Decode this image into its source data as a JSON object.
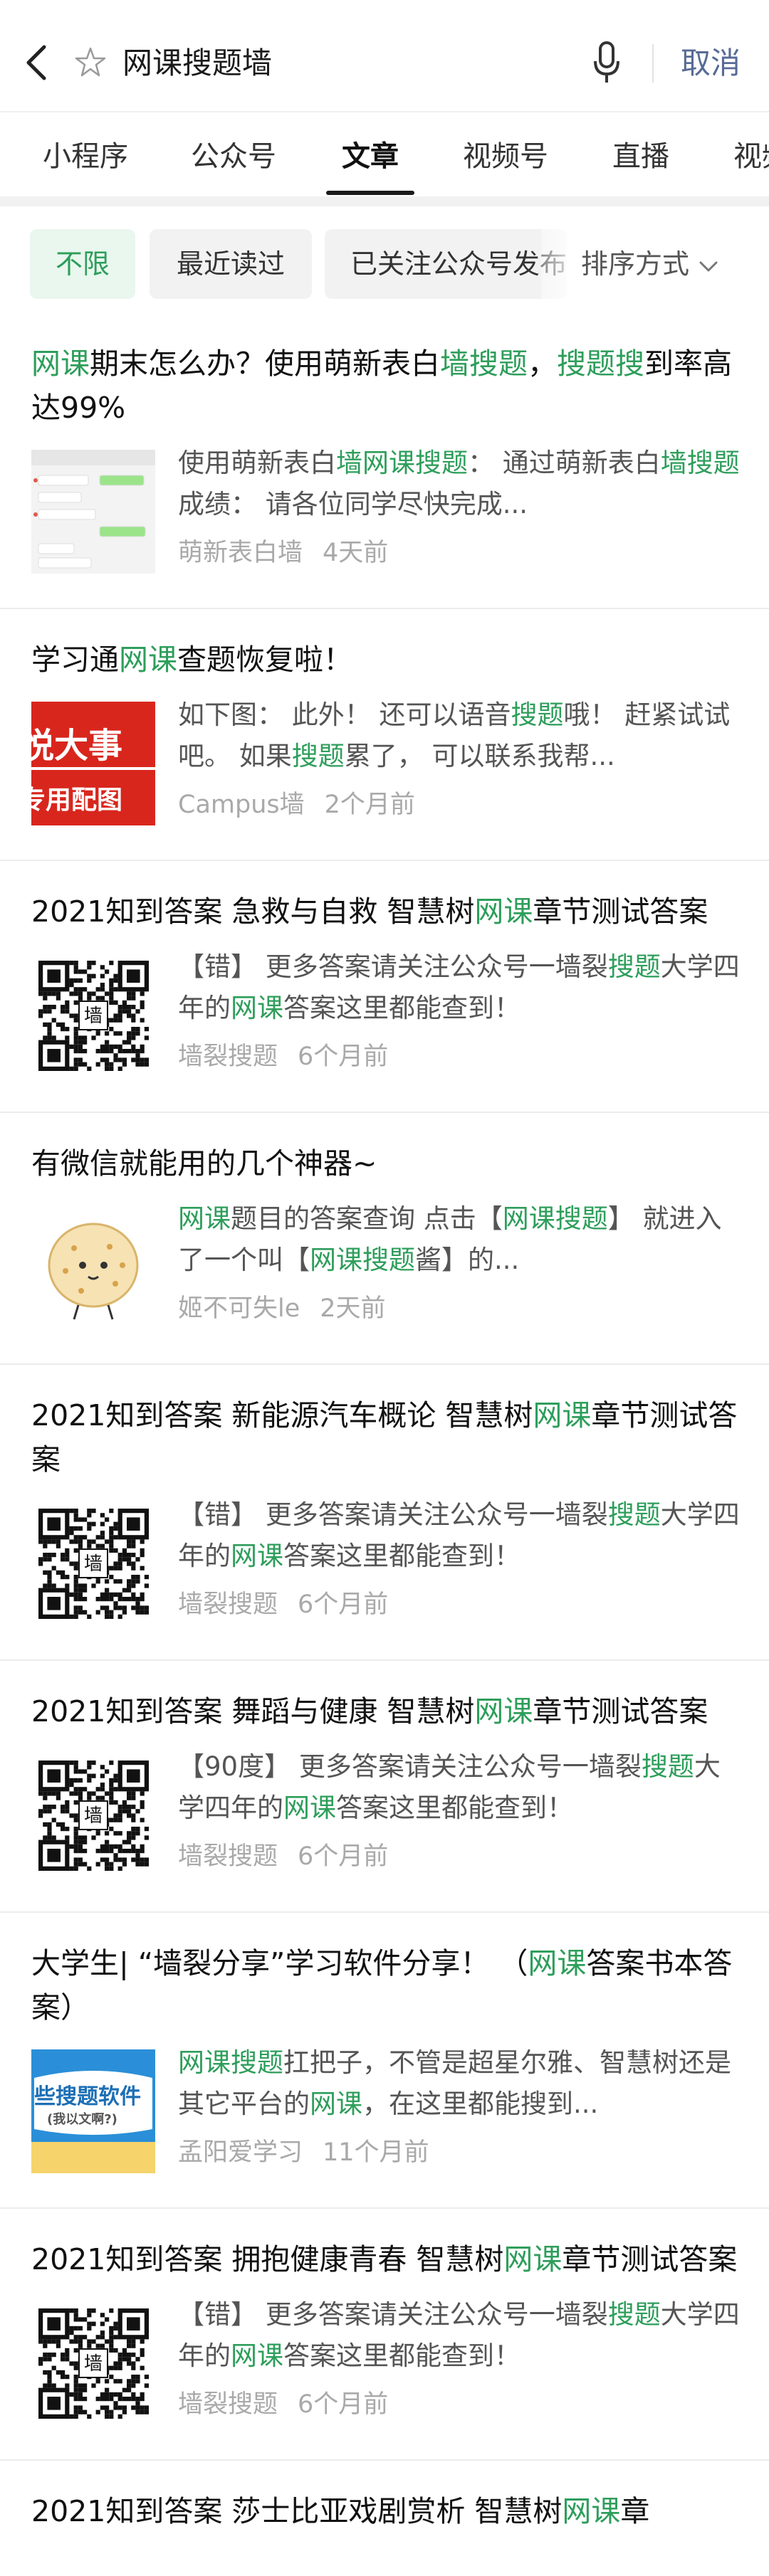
{
  "search": {
    "query": "网课搜题墙",
    "cancel_label": "取消"
  },
  "tabs": [
    {
      "label": "小程序"
    },
    {
      "label": "公众号"
    },
    {
      "label": "文章"
    },
    {
      "label": "视频号"
    },
    {
      "label": "直播"
    },
    {
      "label": "视频"
    }
  ],
  "active_tab": "文章",
  "filters": [
    {
      "label": "不限"
    },
    {
      "label": "最近读过"
    },
    {
      "label": "已关注公众号发布"
    }
  ],
  "sort_label": "排序方式",
  "colors": {
    "accent": "#2e9e5b",
    "link": "#576b95",
    "meta": "#a9a9a9"
  },
  "results": [
    {
      "title": [
        [
          "网课",
          1
        ],
        [
          "期末怎么办？使用萌新表白",
          0
        ],
        [
          "墙搜题",
          1
        ],
        [
          "，",
          0
        ],
        [
          "搜题搜",
          1
        ],
        [
          "到率高达99%",
          0
        ]
      ],
      "snippet": [
        [
          "使用萌新表白",
          0
        ],
        [
          "墙网课搜题",
          1
        ],
        [
          "：  通过萌新表白",
          0
        ],
        [
          "墙搜题",
          1
        ],
        [
          "成绩：  请各位同学尽快完成...",
          0
        ]
      ],
      "source": "萌新表白墙",
      "time": "4天前",
      "thumb": "chat-screenshot"
    },
    {
      "title": [
        [
          "学习通",
          0
        ],
        [
          "网课",
          1
        ],
        [
          "查题恢复啦！",
          0
        ]
      ],
      "snippet": [
        [
          "如下图：  此外！  还可以语音",
          0
        ],
        [
          "搜题",
          1
        ],
        [
          "哦！  赶紧试试吧。  如果",
          0
        ],
        [
          "搜题",
          1
        ],
        [
          "累了，  可以联系我帮...",
          0
        ]
      ],
      "source": "Campus墙",
      "time": "2个月前",
      "thumb": "red-banner",
      "thumb_text": [
        "悦大事",
        "专用配图"
      ]
    },
    {
      "title": [
        [
          "2021知到答案 急救与自救 智慧树",
          0
        ],
        [
          "网课",
          1
        ],
        [
          "章节测试答案",
          0
        ]
      ],
      "snippet": [
        [
          "【错】  更多答案请关注公众号一墙裂",
          0
        ],
        [
          "搜题",
          1
        ],
        [
          "大学四年的",
          0
        ],
        [
          "网课",
          1
        ],
        [
          "答案这里都能查到！",
          0
        ]
      ],
      "source": "墙裂搜题",
      "time": "6个月前",
      "thumb": "qr",
      "thumb_text": [
        "墙"
      ]
    },
    {
      "title": [
        [
          "有微信就能用的几个神器~",
          0
        ]
      ],
      "snippet": [
        [
          "网课",
          1
        ],
        [
          "题目的答案查询 点击【",
          0
        ],
        [
          "网课搜题",
          1
        ],
        [
          "】 就进入了一个叫【",
          0
        ],
        [
          "网课搜题",
          1
        ],
        [
          "酱】的...",
          0
        ]
      ],
      "source": "姬不可失le",
      "time": "2天前",
      "thumb": "mascot"
    },
    {
      "title": [
        [
          "2021知到答案 新能源汽车概论 智慧树",
          0
        ],
        [
          "网课",
          1
        ],
        [
          "章节测试答案",
          0
        ]
      ],
      "snippet": [
        [
          "【错】  更多答案请关注公众号一墙裂",
          0
        ],
        [
          "搜题",
          1
        ],
        [
          "大学四年的",
          0
        ],
        [
          "网课",
          1
        ],
        [
          "答案这里都能查到！",
          0
        ]
      ],
      "source": "墙裂搜题",
      "time": "6个月前",
      "thumb": "qr",
      "thumb_text": [
        "墙"
      ]
    },
    {
      "title": [
        [
          "2021知到答案 舞蹈与健康 智慧树",
          0
        ],
        [
          "网课",
          1
        ],
        [
          "章节测试答案",
          0
        ]
      ],
      "snippet": [
        [
          "【90度】  更多答案请关注公众号一墙裂",
          0
        ],
        [
          "搜题",
          1
        ],
        [
          "大学四年的",
          0
        ],
        [
          "网课",
          1
        ],
        [
          "答案这里都能查到！",
          0
        ]
      ],
      "source": "墙裂搜题",
      "time": "6个月前",
      "thumb": "qr",
      "thumb_text": [
        "墙"
      ]
    },
    {
      "title": [
        [
          "大学生| “墙裂分享”学习软件分享！  （",
          0
        ],
        [
          "网课",
          1
        ],
        [
          "答案书本答案）",
          0
        ]
      ],
      "snippet": [
        [
          "网课搜题",
          1
        ],
        [
          "扛把子，不管是超星尔雅、智慧树还是其它平台的",
          0
        ],
        [
          "网课",
          1
        ],
        [
          "，在这里都能搜到...",
          0
        ]
      ],
      "source": "孟阳爱学习",
      "time": "11个月前",
      "thumb": "cartoon-banner",
      "thumb_text": [
        "些搜题软件",
        "(我以文啊?)"
      ]
    },
    {
      "title": [
        [
          "2021知到答案 拥抱健康青春 智慧树",
          0
        ],
        [
          "网课",
          1
        ],
        [
          "章节测试答案",
          0
        ]
      ],
      "snippet": [
        [
          "【错】  更多答案请关注公众号一墙裂",
          0
        ],
        [
          "搜题",
          1
        ],
        [
          "大学四年的",
          0
        ],
        [
          "网课",
          1
        ],
        [
          "答案这里都能查到！",
          0
        ]
      ],
      "source": "墙裂搜题",
      "time": "6个月前",
      "thumb": "qr",
      "thumb_text": [
        "墙"
      ]
    },
    {
      "title": [
        [
          "2021知到答案 莎士比亚戏剧赏析 智慧树",
          0
        ],
        [
          "网课",
          1
        ],
        [
          "章",
          0
        ]
      ],
      "snippet": [],
      "source": "",
      "time": "",
      "thumb": "none"
    }
  ]
}
